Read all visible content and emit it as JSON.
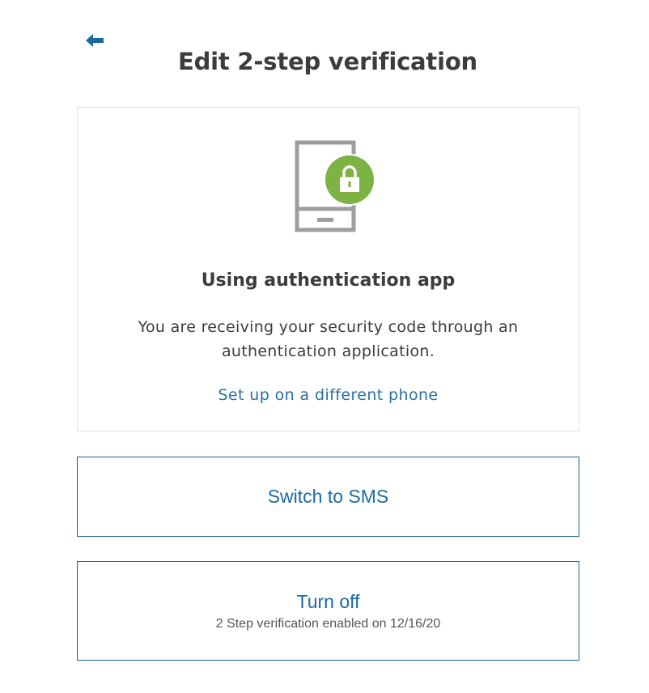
{
  "header": {
    "back_icon": "arrow-left-icon",
    "title": "Edit 2-step verification"
  },
  "card": {
    "illustration_icon": "phone-lock-icon",
    "title": "Using authentication app",
    "description": "You are receiving your security code through an authentication application.",
    "link_label": "Set up on a different phone"
  },
  "actions": {
    "switch_label": "Switch to SMS",
    "turn_off_label": "Turn off",
    "turn_off_subtext": "2 Step verification enabled on 12/16/20"
  },
  "colors": {
    "accent": "#1a6aa6",
    "lock_green": "#7cb342",
    "phone_gray": "#9e9e9e"
  }
}
